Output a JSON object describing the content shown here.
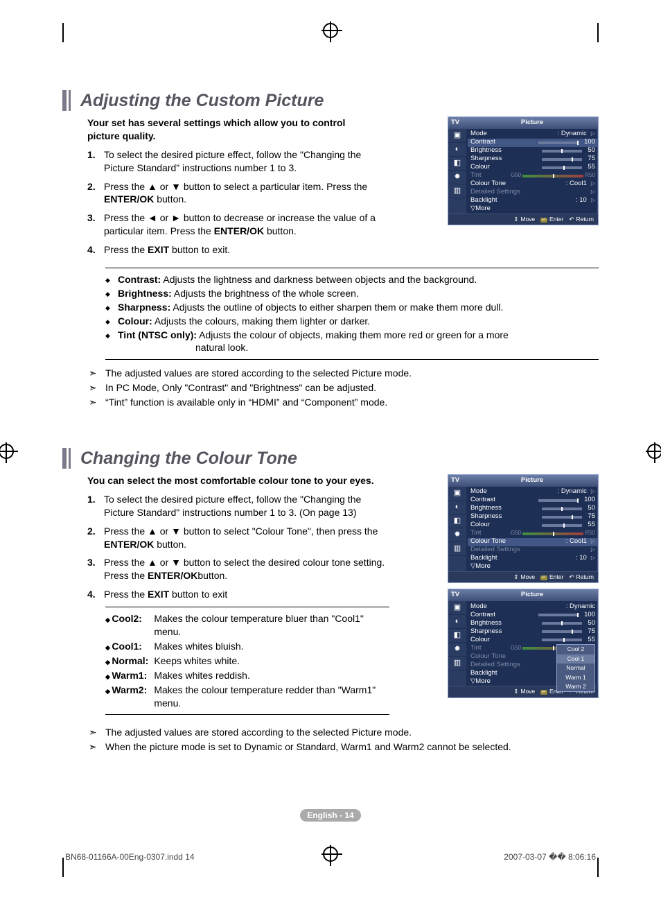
{
  "section1": {
    "title": "Adjusting the Custom Picture",
    "intro": "Your set has several settings which allow you to control picture quality.",
    "steps": [
      "To select the desired picture effect, follow the \"Changing the Picture Standard\" instructions number 1 to 3.",
      "Press the ▲ or ▼ button to select a particular item. Press the ENTER/OK button.",
      "Press the ◄ or ► button to decrease or increase the value of a particular item. Press the ENTER/OK button.",
      "Press the EXIT button to exit."
    ],
    "bullets": [
      {
        "term": "Contrast:",
        "desc": "Adjusts the lightness and darkness between objects and the background."
      },
      {
        "term": "Brightness:",
        "desc": "Adjusts the brightness of the whole screen."
      },
      {
        "term": "Sharpness:",
        "desc": "Adjusts the outline of objects to either sharpen them or make them more dull."
      },
      {
        "term": "Colour:",
        "desc": "Adjusts the colours, making them lighter or darker."
      },
      {
        "term": "Tint (NTSC only):",
        "desc": "Adjusts the colour of objects, making them more red or green for a more natural look."
      }
    ],
    "notes": [
      "The adjusted values are stored according to the selected Picture mode.",
      "In PC Mode, Only \"Contrast\" and \"Brightness\" can be adjusted.",
      "“Tint” function is available only in “HDMI” and “Component” mode."
    ]
  },
  "section2": {
    "title": "Changing the Colour Tone",
    "intro": "You can select the most comfortable colour tone to your eyes.",
    "steps": [
      "To select the desired picture effect, follow the \"Changing the Picture Standard\" instructions number 1 to 3. (On page 13)",
      "Press the ▲ or ▼ button to select \"Colour Tone\", then press the ENTER/OK button.",
      "Press the ▲ or ▼ button to select the desired colour tone setting. Press the ENTER/OKbutton.",
      "Press the EXIT button to exit"
    ],
    "defs": [
      {
        "term": "Cool2:",
        "desc": "Makes the colour temperature bluer than \"Cool1\" menu."
      },
      {
        "term": "Cool1:",
        "desc": "Makes whites bluish."
      },
      {
        "term": "Normal:",
        "desc": "Keeps whites white."
      },
      {
        "term": "Warm1:",
        "desc": "Makes whites reddish."
      },
      {
        "term": "Warm2:",
        "desc": "Makes the colour temperature redder than \"Warm1\" menu."
      }
    ],
    "notes": [
      "The adjusted values are stored according to the selected Picture mode.",
      "When the picture mode is set to Dynamic or Standard, Warm1 and Warm2 cannot be selected."
    ]
  },
  "osd": {
    "tv": "TV",
    "title": "Picture",
    "mode": "Mode",
    "dynamic": ": Dynamic",
    "contrast": "Contrast",
    "contrast_v": "100",
    "brightness": "Brightness",
    "brightness_v": "50",
    "sharpness": "Sharpness",
    "sharpness_v": "75",
    "colour": "Colour",
    "colour_v": "55",
    "tint": "Tint",
    "tint_g": "G50",
    "tint_r": "R50",
    "colour_tone": "Colour Tone",
    "cool1": ": Cool1",
    "detailed": "Detailed Settings",
    "backlight": "Backlight",
    "backlight_v": ": 10",
    "more": "▽More",
    "move": "Move",
    "enter": "Enter",
    "return": "Return",
    "dd": {
      "cool2": "Cool 2",
      "cool1": "Cool 1",
      "normal": "Normal",
      "warm1": "Warm 1",
      "warm2": "Warm 2"
    }
  },
  "footer": {
    "pagenum": "English - 14",
    "doc": "BN68-01166A-00Eng-0307.indd   14",
    "date": "2007-03-07   �� 8:06:16"
  }
}
